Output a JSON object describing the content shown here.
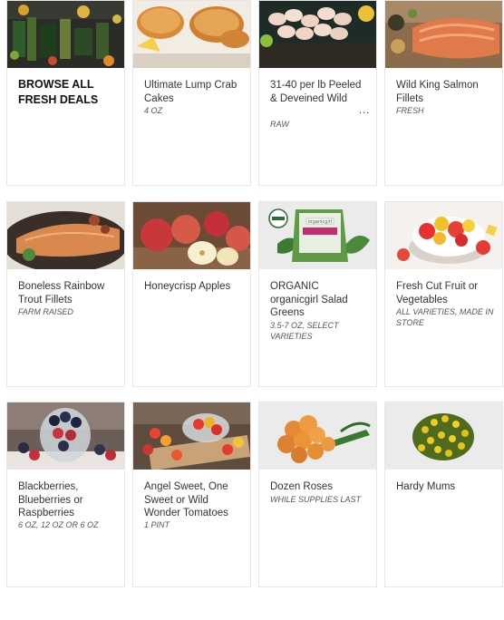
{
  "deals": [
    {
      "title": "BROWSE ALL FRESH DEALS",
      "subtitle": "",
      "image": "produce-assortment"
    },
    {
      "title": "Ultimate Lump Crab Cakes",
      "subtitle": "4 OZ",
      "image": "crab-cakes"
    },
    {
      "title": "31-40 per lb Peeled & Deveined Wild",
      "subtitle": "RAW",
      "image": "shrimp"
    },
    {
      "title": "Wild King Salmon Fillets",
      "subtitle": "FRESH",
      "image": "salmon"
    },
    {
      "title": "Boneless Rainbow Trout Fillets",
      "subtitle": "FARM RAISED",
      "image": "trout"
    },
    {
      "title": "Honeycrisp Apples",
      "subtitle": "",
      "image": "apples"
    },
    {
      "title": "ORGANIC organicgirl Salad Greens",
      "subtitle": "3.5-7 OZ, SELECT VARIETIES",
      "image": "salad-greens"
    },
    {
      "title": "Fresh Cut Fruit or Vegetables",
      "subtitle": "ALL VARIETIES, MADE IN STORE",
      "image": "cut-fruit"
    },
    {
      "title": "Blackberries, Blueberries or Raspberries",
      "subtitle": "6 OZ, 12 OZ OR 6 OZ",
      "image": "berries"
    },
    {
      "title": "Angel Sweet, One Sweet or Wild Wonder Tomatoes",
      "subtitle": "1 PINT",
      "image": "tomatoes"
    },
    {
      "title": "Dozen Roses",
      "subtitle": "WHILE SUPPLIES LAST",
      "image": "roses"
    },
    {
      "title": "Hardy Mums",
      "subtitle": "",
      "image": "mums"
    }
  ],
  "ellipsis": "...",
  "salad_package_label": "organicgirl"
}
